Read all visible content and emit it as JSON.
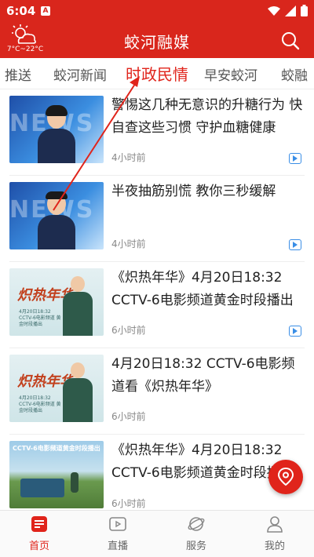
{
  "status_bar": {
    "time": "6:04",
    "notification_letter": "A"
  },
  "header": {
    "app_title": "蛟河融媒",
    "weather_temp": "7°C~22°C"
  },
  "tabs": [
    {
      "label": "推送",
      "active": false
    },
    {
      "label": "蛟河新闻",
      "active": false
    },
    {
      "label": "时政民情",
      "active": true
    },
    {
      "label": "早安蛟河",
      "active": false
    },
    {
      "label": "蛟融",
      "active": false
    }
  ],
  "articles": [
    {
      "headline": "警惕这几种无意识的升糖行为 快自查这些习惯 守护血糖健康",
      "time": "4小时前",
      "has_video": true
    },
    {
      "headline": "半夜抽筋别慌 教你三秒缓解",
      "time": "4小时前",
      "has_video": true
    },
    {
      "headline": "《炽热年华》4月20日18:32 CCTV-6电影频道黄金时段播出",
      "time": "6小时前",
      "has_video": true
    },
    {
      "headline": "4月20日18:32 CCTV-6电影频道看《炽热年华》",
      "time": "6小时前",
      "has_video": false
    },
    {
      "headline": "《炽热年华》4月20日18:32 CCTV-6电影频道黄金时段播",
      "time": "6小时前",
      "has_video": false
    }
  ],
  "thumb_text": {
    "news_bg": "NEWS",
    "poster_title": "炽热年华",
    "poster_small": "4月20日18:32 CCTV-6电影频道 黄金时段播出",
    "field_banner": "CCTV-6电影频道黄金时段播出"
  },
  "bottom_nav": [
    {
      "label": "首页",
      "active": true
    },
    {
      "label": "直播",
      "active": false
    },
    {
      "label": "服务",
      "active": false
    },
    {
      "label": "我的",
      "active": false
    }
  ],
  "colors": {
    "brand_red": "#d9261c",
    "active_red": "#e0241b",
    "video_blue": "#3a8ee6"
  }
}
